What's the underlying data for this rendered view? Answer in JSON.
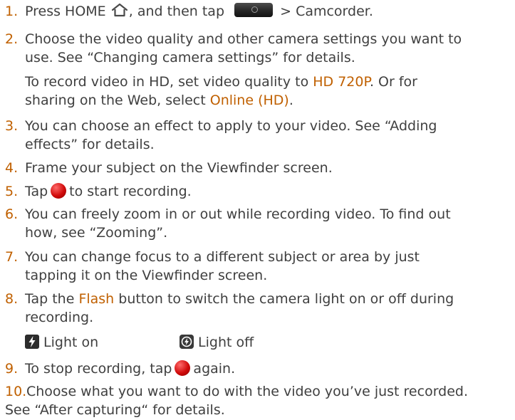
{
  "steps": [
    {
      "number": "1.",
      "parts": [
        "Press HOME",
        ", and then tap",
        "> Camcorder."
      ],
      "accent_color": "#c06000"
    },
    {
      "number": "2.",
      "lines": [
        "Choose the video quality and other camera settings you want to",
        "use. See “Changing camera settings” for details."
      ],
      "note": {
        "line1_prefix": "To record video in HD, set video quality to ",
        "line1_value": "HD 720P",
        "line1_suffix": ". Or for",
        "line2_prefix": "sharing on the Web, select ",
        "line2_value": "Online (HD)",
        "line2_suffix": "."
      }
    },
    {
      "number": "3.",
      "lines": [
        "You can choose an effect to apply to your video. See “Adding",
        "effects” for details."
      ]
    },
    {
      "number": "4.",
      "lines": [
        "Frame your subject on the Viewfinder screen."
      ]
    },
    {
      "number": "5.",
      "before": "Tap",
      "after": "to start recording."
    },
    {
      "number": "6.",
      "lines": [
        "You can freely zoom in or out while recording video. To find out",
        "how, see “Zooming”."
      ]
    },
    {
      "number": "7.",
      "lines": [
        "You can change focus to a different subject or area by just",
        "tapping it on the Viewfinder screen."
      ]
    },
    {
      "number": "8.",
      "line1_prefix": "Tap the ",
      "line1_value": "Flash",
      "line1_suffix": " button to switch the camera light on or off during",
      "line2": "recording.",
      "flash_on_label": "Light on",
      "flash_off_label": "Light off"
    },
    {
      "number": "9.",
      "before": "To stop recording, tap",
      "after": "again."
    },
    {
      "number": "10.",
      "lines": [
        "Choose what you want to do with the video you’ve just recorded.",
        "See “After capturing“ for details."
      ]
    }
  ],
  "icons": {
    "home": "home-icon",
    "app": "camera-app-icon",
    "record": "record-button-icon",
    "flash_on": "flash-on-icon",
    "flash_off": "flash-off-icon"
  },
  "colors": {
    "text": "#3f3f3f",
    "accent": "#c06000",
    "record": "#d10b0b"
  }
}
